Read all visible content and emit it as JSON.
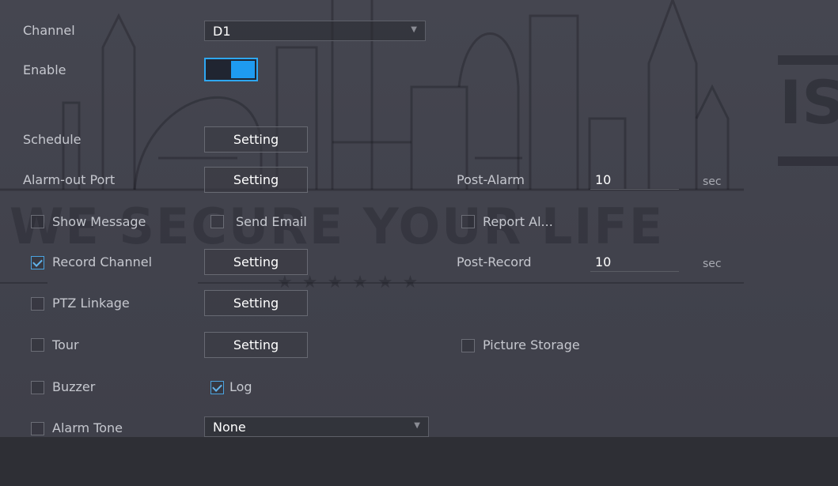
{
  "settings": {
    "channel_label": "Channel",
    "channel_value": "D1",
    "enable_label": "Enable",
    "enable_on": true,
    "schedule_label": "Schedule",
    "schedule_button": "Setting",
    "alarm_out_label": "Alarm-out Port",
    "alarm_out_button": "Setting",
    "post_alarm_label": "Post-Alarm",
    "post_alarm_value": "10",
    "post_alarm_unit": "sec",
    "show_message_label": "Show Message",
    "show_message_checked": false,
    "send_email_label": "Send Email",
    "send_email_checked": false,
    "report_alarm_label": "Report Al...",
    "report_alarm_checked": false,
    "record_channel_label": "Record Channel",
    "record_channel_checked": true,
    "record_channel_button": "Setting",
    "post_record_label": "Post-Record",
    "post_record_value": "10",
    "post_record_unit": "sec",
    "ptz_label": "PTZ Linkage",
    "ptz_checked": false,
    "ptz_button": "Setting",
    "tour_label": "Tour",
    "tour_checked": false,
    "tour_button": "Setting",
    "picture_storage_label": "Picture Storage",
    "picture_storage_checked": false,
    "buzzer_label": "Buzzer",
    "buzzer_checked": false,
    "log_label": "Log",
    "log_checked": true,
    "alarm_tone_label": "Alarm Tone",
    "alarm_tone_checked": false,
    "alarm_tone_value": "None"
  },
  "watermark": {
    "text": "WE SECURE YOUR LIFE",
    "stars": "★★★★★★",
    "logo": "IS"
  },
  "colors": {
    "accent": "#1e9bf0",
    "panel": "#43444e",
    "footer": "#2e2f35"
  }
}
